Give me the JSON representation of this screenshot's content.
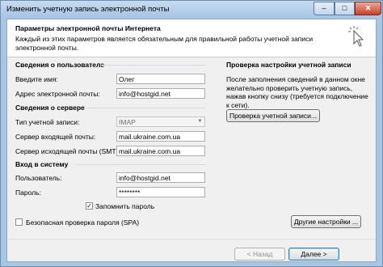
{
  "window": {
    "title": "Изменить учетную запись электронной почты"
  },
  "controls": {
    "min": "–",
    "max": "□",
    "close": "✕"
  },
  "header": {
    "title": "Параметры электронной почты Интернета",
    "description": "Каждый из этих параметров является обязательным для правильной работы учетной записи электронной почты."
  },
  "user_info": {
    "heading": "Сведения о пользователе",
    "name_label": "Введите имя:",
    "name_value": "Олег",
    "email_label": "Адрес электронной почты:",
    "email_value": "info@hostgid.net"
  },
  "server_info": {
    "heading": "Сведения о сервере",
    "type_label": "Тип учетной записи:",
    "type_value": "IMAP",
    "incoming_label": "Сервер входящей почты:",
    "incoming_value": "mail.ukraine.com.ua",
    "outgoing_label": "Сервер исходящей почты (SMTP):",
    "outgoing_value": "mail.ukraine.com.ua"
  },
  "login": {
    "heading": "Вход в систему",
    "user_label": "Пользователь:",
    "user_value": "info@hostgid.net",
    "password_label": "Пароль:",
    "password_value": "********",
    "remember_label": "Запомнить пароль",
    "remember_checked": true,
    "spa_label": "Безопасная проверка пароля (SPA)",
    "spa_checked": false
  },
  "test": {
    "heading": "Проверка настройки учетной записи",
    "description": "После заполнения сведений в данном окне желательно проверить учетную запись, нажав кнопку снизу (требуется подключение к сети).",
    "button": "Проверка учетной записи..."
  },
  "buttons": {
    "more_settings": "Другие настройки ...",
    "back": "< Назад",
    "next": "Далее >"
  }
}
